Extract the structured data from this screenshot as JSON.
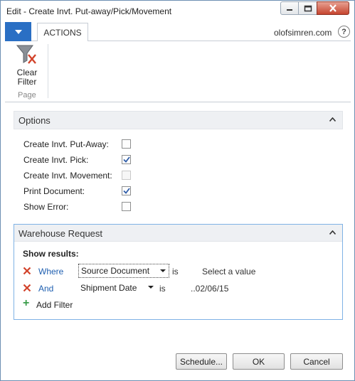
{
  "window": {
    "title": "Edit - Create Invt. Put-away/Pick/Movement"
  },
  "ribbon": {
    "tab_label": "ACTIONS",
    "user": "olofsimren.com",
    "help_label": "?",
    "clear_filter_label": "Clear Filter",
    "group_label": "Page"
  },
  "options": {
    "title": "Options",
    "rows": [
      {
        "label": "Create Invt. Put-Away:",
        "checked": false,
        "enabled": true
      },
      {
        "label": "Create Invt. Pick:",
        "checked": true,
        "enabled": true
      },
      {
        "label": "Create Invt. Movement:",
        "checked": false,
        "enabled": false
      },
      {
        "label": "Print Document:",
        "checked": true,
        "enabled": true
      },
      {
        "label": "Show Error:",
        "checked": false,
        "enabled": true
      }
    ]
  },
  "warehouse_request": {
    "title": "Warehouse Request",
    "show_results": "Show results:",
    "filters": [
      {
        "conjunction": "Where",
        "field": "Source Document",
        "operator": "is",
        "value": "Select a value"
      },
      {
        "conjunction": "And",
        "field": "Shipment Date",
        "operator": "is",
        "value": "..02/06/15"
      }
    ],
    "add_filter_label": "Add Filter"
  },
  "footer": {
    "schedule_label": "Schedule...",
    "ok_label": "OK",
    "cancel_label": "Cancel"
  },
  "colors": {
    "menu_blue": "#2a6fc4",
    "link_blue": "#1f5fb0",
    "remove_red": "#d2432b",
    "add_green": "#3a9d4a",
    "panel_border": "#7fb2e5"
  }
}
